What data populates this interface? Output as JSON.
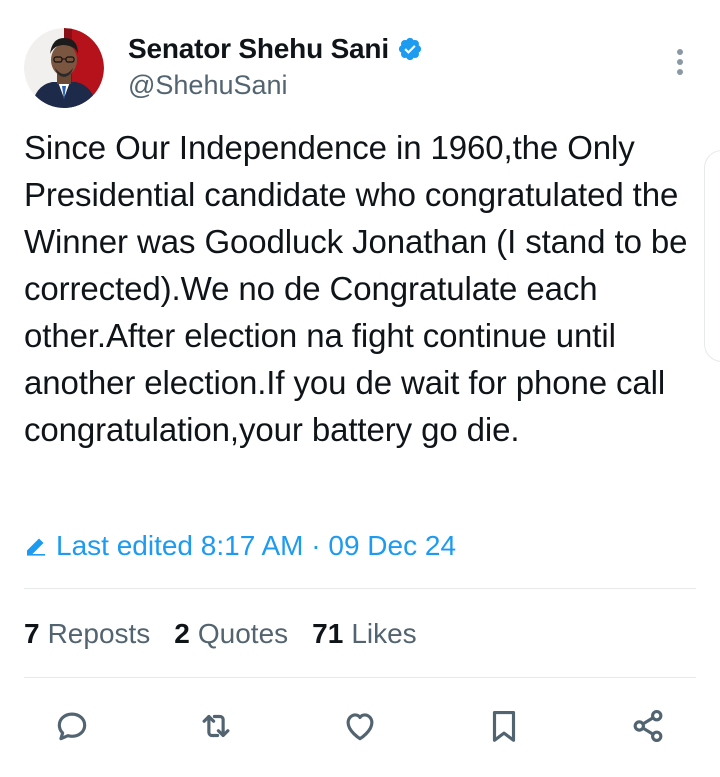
{
  "tweet": {
    "author": {
      "display_name": "Senator Shehu Sani",
      "handle": "@ShehuSani",
      "verified": true
    },
    "text": "Since Our Independence in 1960,the Only Presidential candidate who congratulated the Winner was Goodluck Jonathan (I stand to be corrected).We no de Congratulate each other.After election na fight continue until another election.If you de wait for phone call congratulation,your battery go die.",
    "edited": {
      "label": "Last edited 8:17 AM · 09 Dec 24"
    },
    "stats": {
      "reposts": {
        "count": "7",
        "label": "Reposts"
      },
      "quotes": {
        "count": "2",
        "label": "Quotes"
      },
      "likes": {
        "count": "71",
        "label": "Likes"
      }
    },
    "actions": [
      "reply-icon",
      "repost-icon",
      "like-icon",
      "bookmark-icon",
      "share-icon"
    ]
  },
  "colors": {
    "accent": "#1d9bf0",
    "text_primary": "#0f1419",
    "text_secondary": "#536471",
    "divider": "#e7e9ea"
  }
}
